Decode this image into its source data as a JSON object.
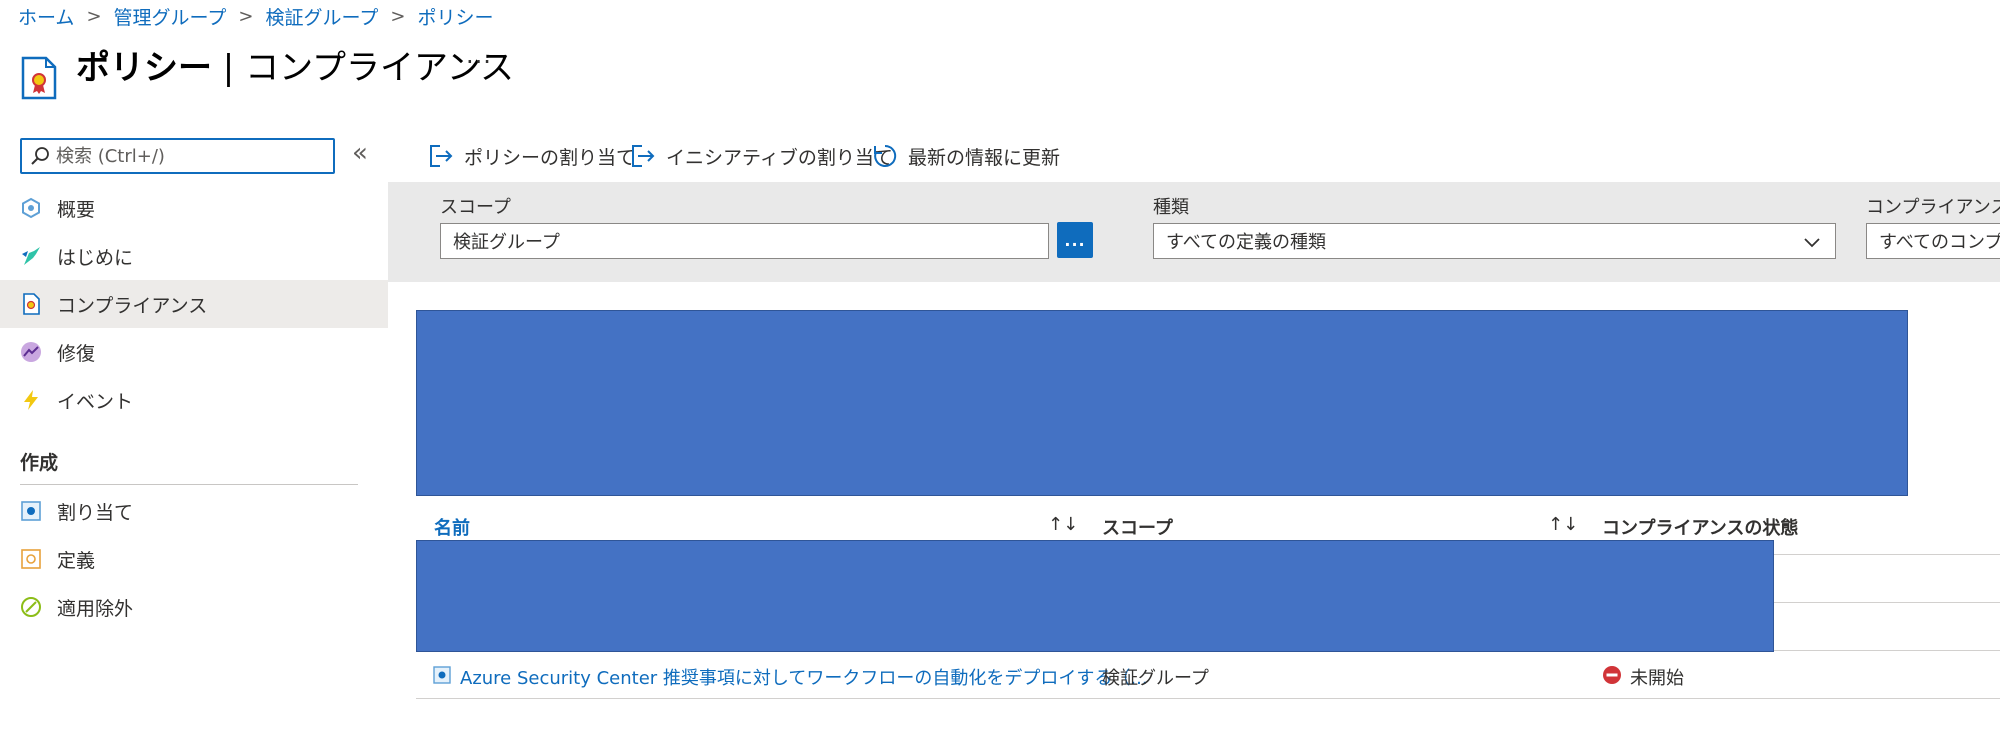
{
  "breadcrumb": [
    {
      "label": "ホーム"
    },
    {
      "label": "管理グループ"
    },
    {
      "label": "検証グループ"
    },
    {
      "label": "ポリシー"
    }
  ],
  "breadcrumb_separator": ">",
  "header": {
    "title_bold": "ポリシー",
    "title_sep": " | ",
    "title_rest": "コンプライアンス",
    "more": "···"
  },
  "sidebar": {
    "search_placeholder": "検索 (Ctrl+/)",
    "collapse": "«",
    "items": [
      {
        "label": "概要",
        "icon": "overview-icon"
      },
      {
        "label": "はじめに",
        "icon": "getting-started-icon"
      },
      {
        "label": "コンプライアンス",
        "icon": "compliance-icon",
        "selected": true
      },
      {
        "label": "修復",
        "icon": "remediation-icon"
      },
      {
        "label": "イベント",
        "icon": "events-icon"
      }
    ],
    "section": "作成",
    "section_items": [
      {
        "label": "割り当て",
        "icon": "assignment-icon"
      },
      {
        "label": "定義",
        "icon": "definition-icon"
      },
      {
        "label": "適用除外",
        "icon": "exemption-icon"
      }
    ]
  },
  "toolbar": {
    "assign_policy": "ポリシーの割り当て",
    "assign_initiative": "イニシアティブの割り当て",
    "refresh": "最新の情報に更新"
  },
  "filters": {
    "scope_label": "スコープ",
    "scope_value": "検証グループ",
    "scope_more": "...",
    "type_label": "種類",
    "type_value": "すべての定義の種類",
    "compliance_label": "コンプライアンスの状態",
    "compliance_value": "すべてのコンプライアンスの状態"
  },
  "table": {
    "columns": {
      "name": "名前",
      "scope": "スコープ",
      "compliance": "コンプライアンスの状態"
    },
    "sort_glyph": "↑↓",
    "rows": [
      {
        "name": "Azure Security Center 推奨事項に対してワークフローの自動化をデプロイする（...",
        "scope": "検証グループ",
        "status": "未開始",
        "status_color": "#d13438"
      }
    ]
  },
  "colors": {
    "accent": "#0f6cbd",
    "redaction": "#4472c4",
    "selected_nav": "#edebe9",
    "filter_band": "#e9e9e9"
  }
}
